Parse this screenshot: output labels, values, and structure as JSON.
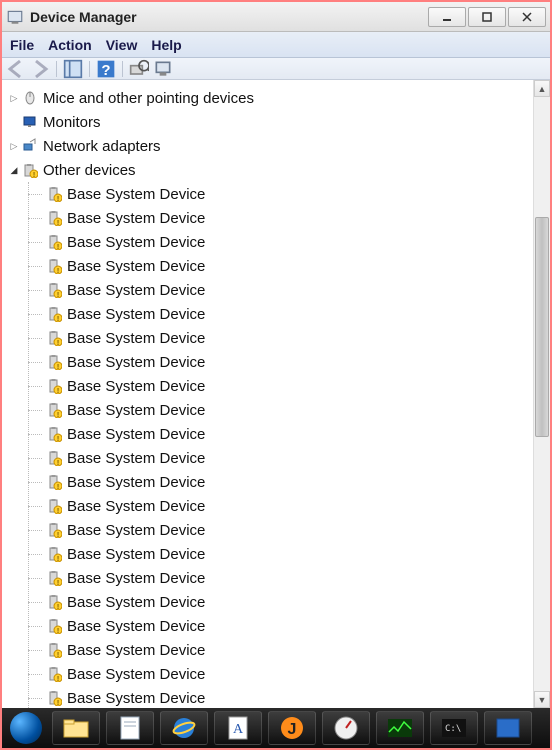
{
  "window": {
    "title": "Device Manager"
  },
  "menu": {
    "file": "File",
    "action": "Action",
    "view": "View",
    "help": "Help"
  },
  "tree": {
    "top": [
      {
        "label": "Mice and other pointing devices",
        "icon": "mouse",
        "expander": "▷"
      },
      {
        "label": "Monitors",
        "icon": "monitor",
        "expander": ""
      },
      {
        "label": "Network adapters",
        "icon": "network",
        "expander": "▷"
      }
    ],
    "other": {
      "label": "Other devices",
      "expander": "◢",
      "children_label": "Base System Device",
      "children_count": 23
    }
  },
  "taskbar": {
    "items": [
      "start",
      "explorer",
      "notes",
      "ie",
      "wordpad",
      "java",
      "gauge",
      "taskmgr",
      "cmd",
      "app"
    ]
  }
}
